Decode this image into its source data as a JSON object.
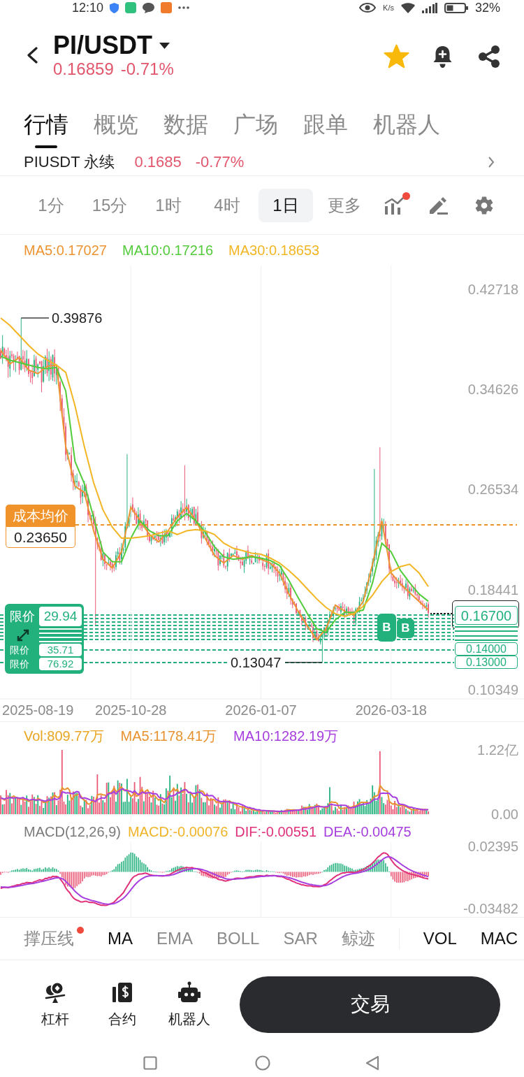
{
  "status_bar": {
    "time": "12:10",
    "speed": "K/s",
    "battery": "32%"
  },
  "header": {
    "pair": "PI/USDT",
    "price": "0.16859",
    "change": "-0.71%",
    "favorite": true
  },
  "tabs": [
    {
      "label": "行情",
      "selected": true
    },
    {
      "label": "概览",
      "selected": false
    },
    {
      "label": "数据",
      "selected": false
    },
    {
      "label": "广场",
      "selected": false
    },
    {
      "label": "跟单",
      "selected": false
    },
    {
      "label": "机器人",
      "selected": false
    }
  ],
  "contract_row": {
    "name": "PIUSDT 永续",
    "price": "0.1685",
    "change": "-0.77%"
  },
  "timeframes": [
    {
      "label": "1分",
      "selected": false
    },
    {
      "label": "15分",
      "selected": false
    },
    {
      "label": "1时",
      "selected": false
    },
    {
      "label": "4时",
      "selected": false
    },
    {
      "label": "1日",
      "selected": true
    },
    {
      "label": "更多",
      "selected": false
    }
  ],
  "chart_tools": {
    "indicator_dot": true
  },
  "ma_legend": [
    {
      "label": "MA5:0.17027",
      "color": "#ee9332"
    },
    {
      "label": "MA10:0.17216",
      "color": "#52cc3a"
    },
    {
      "label": "MA30:0.18653",
      "color": "#f2b624"
    }
  ],
  "main_chart": {
    "chart_data": {
      "type": "line",
      "categories": [
        null,
        null,
        null,
        null,
        "2025-08-19",
        null,
        null,
        null,
        null,
        null,
        null,
        null,
        null,
        null,
        "2025-10-28",
        null,
        null,
        null,
        null,
        null,
        null,
        null,
        null,
        null,
        null,
        null,
        null,
        null,
        "2026-01-07",
        null,
        null,
        null,
        null,
        null,
        null,
        null,
        null,
        null,
        null,
        null,
        null,
        null,
        "2026-03-18",
        null,
        null,
        null,
        null
      ],
      "ylim": [
        0.10349,
        0.42718
      ],
      "yticks": [
        0.42718,
        0.34626,
        0.26534,
        0.18441,
        0.10349
      ],
      "series": [
        {
          "color": "#ee9332",
          "values": [
            0.378,
            0.367,
            0.372,
            0.362,
            0.359,
            0.365,
            0.366,
            0.3,
            0.268,
            0.263,
            0.232,
            0.209,
            0.202,
            0.215,
            0.251,
            0.24,
            0.229,
            0.223,
            0.232,
            0.243,
            0.251,
            0.24,
            0.226,
            0.212,
            0.206,
            0.212,
            0.209,
            0.212,
            0.209,
            0.206,
            0.198,
            0.181,
            0.167,
            0.155,
            0.144,
            0.153,
            0.172,
            0.167,
            0.164,
            0.175,
            0.205,
            0.24,
            0.198,
            0.189,
            0.182,
            0.175,
            0.168
          ]
        },
        {
          "color": "#52cc3a",
          "values": [
            0.373,
            0.37,
            0.368,
            0.366,
            0.364,
            0.363,
            0.364,
            0.345,
            0.288,
            0.27,
            0.243,
            0.215,
            0.207,
            0.207,
            0.226,
            0.24,
            0.232,
            0.228,
            0.228,
            0.24,
            0.246,
            0.24,
            0.231,
            0.219,
            0.211,
            0.209,
            0.21,
            0.211,
            0.21,
            0.208,
            0.204,
            0.192,
            0.178,
            0.165,
            0.153,
            0.15,
            0.16,
            0.166,
            0.166,
            0.168,
            0.19,
            0.222,
            0.215,
            0.2,
            0.19,
            0.181,
            0.175
          ]
        },
        {
          "color": "#f2b624",
          "values": [
            0.404,
            0.398,
            0.39,
            0.382,
            0.375,
            0.37,
            0.366,
            0.36,
            0.333,
            0.3,
            0.271,
            0.249,
            0.235,
            0.226,
            0.226,
            0.227,
            0.228,
            0.23,
            0.232,
            0.229,
            0.232,
            0.233,
            0.232,
            0.229,
            0.222,
            0.218,
            0.216,
            0.214,
            0.213,
            0.21,
            0.206,
            0.2,
            0.193,
            0.185,
            0.177,
            0.17,
            0.165,
            0.163,
            0.165,
            0.171,
            0.18,
            0.191,
            0.199,
            0.203,
            0.205,
            0.198,
            0.187
          ]
        }
      ]
    },
    "high_label": "0.39876",
    "low_label": "0.13047",
    "cost": {
      "label": "成本均价",
      "value": "0.23650"
    },
    "limit_orders": [
      {
        "label": "限价",
        "value": "29.94"
      },
      {
        "label": "限价",
        "value": "35.71"
      },
      {
        "label": "限价",
        "value": "76.92"
      }
    ],
    "price_tags": [
      "0.16700",
      "0.14000",
      "0.13000"
    ],
    "trade_markers": [
      "B",
      "B"
    ]
  },
  "volume": {
    "legend": [
      {
        "label": "Vol:809.77万",
        "color": "#e8a623"
      },
      {
        "label": "MA5:1178.41万",
        "color": "#e8932f"
      },
      {
        "label": "MA10:1282.19万",
        "color": "#a63ee0"
      }
    ],
    "y_labels": [
      "1.22亿",
      "0.00"
    ]
  },
  "macd": {
    "legend": [
      {
        "label": "MACD(12,26,9)",
        "color": "#7a7a7a"
      },
      {
        "label": "MACD:-0.00076",
        "color": "#f0b429"
      },
      {
        "label": "DIF:-0.00551",
        "color": "#e0317a"
      },
      {
        "label": "DEA:-0.00475",
        "color": "#a63fde"
      }
    ],
    "y_labels": [
      "0.02395",
      "-0.03482"
    ]
  },
  "main_indicators": [
    {
      "label": "撑压线",
      "selected": false,
      "dot": true
    },
    {
      "label": "MA",
      "selected": true,
      "dot": false
    },
    {
      "label": "EMA",
      "selected": false,
      "dot": false
    },
    {
      "label": "BOLL",
      "selected": false,
      "dot": false
    },
    {
      "label": "SAR",
      "selected": false,
      "dot": false
    },
    {
      "label": "鲸迹",
      "selected": false,
      "dot": false
    }
  ],
  "sub_indicators": [
    {
      "label": "VOL",
      "selected": true
    },
    {
      "label": "MAC",
      "selected": true
    }
  ],
  "bottom_bar": {
    "actions": [
      {
        "label": "杠杆",
        "kind": "leverage"
      },
      {
        "label": "合约",
        "kind": "contract"
      },
      {
        "label": "机器人",
        "kind": "robot"
      }
    ],
    "trade_button": "交易"
  }
}
